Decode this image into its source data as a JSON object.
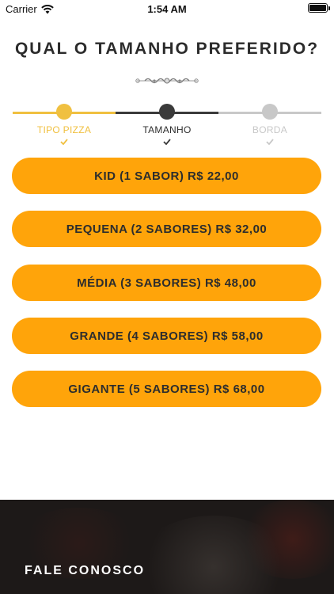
{
  "status_bar": {
    "carrier": "Carrier",
    "time": "1:54 AM",
    "icons": [
      "wifi-icon",
      "battery-icon"
    ]
  },
  "page": {
    "title": "QUAL O TAMANHO PREFERIDO?"
  },
  "stepper": {
    "steps": [
      {
        "label": "TIPO PIZZA",
        "state": "completed",
        "color": "#f0c040"
      },
      {
        "label": "TAMANHO",
        "state": "active",
        "color": "#3a3a3a"
      },
      {
        "label": "BORDA",
        "state": "pending",
        "color": "#c8c8c8"
      }
    ]
  },
  "options": [
    {
      "label": "KID (1 SABOR) R$ 22,00"
    },
    {
      "label": "PEQUENA (2 SABORES) R$ 32,00"
    },
    {
      "label": "MÉDIA (3 SABORES) R$ 48,00"
    },
    {
      "label": "GRANDE (4 SABORES) R$ 58,00"
    },
    {
      "label": "GIGANTE (5 SABORES) R$ 68,00"
    }
  ],
  "footer": {
    "title": "FALE CONOSCO"
  },
  "colors": {
    "accent": "#ffa40a",
    "step_done": "#f0c040",
    "step_active": "#3a3a3a",
    "step_pending": "#c8c8c8",
    "footer_bg": "#1d1918"
  }
}
